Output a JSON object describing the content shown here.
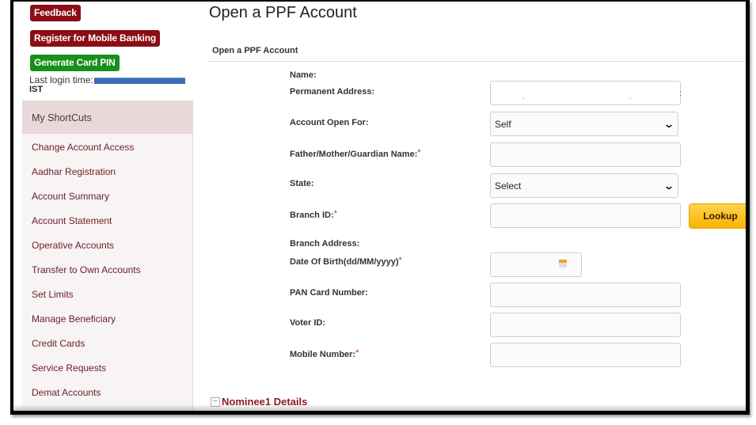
{
  "top_buttons": {
    "feedback": "Feedback",
    "register_mobile_banking": "Register for Mobile Banking",
    "generate_card_pin": "Generate Card PIN"
  },
  "last_login": {
    "label": "Last login time:",
    "timezone": "IST"
  },
  "sidebar": {
    "header": "My ShortCuts",
    "items": [
      {
        "label": "Change Account Access"
      },
      {
        "label": "Aadhar Registration"
      },
      {
        "label": "Account Summary"
      },
      {
        "label": "Account Statement"
      },
      {
        "label": "Operative Accounts"
      },
      {
        "label": "Transfer to Own Accounts"
      },
      {
        "label": "Set Limits"
      },
      {
        "label": "Manage Beneficiary"
      },
      {
        "label": "Credit Cards"
      },
      {
        "label": "Service Requests"
      },
      {
        "label": "Demat Accounts"
      }
    ]
  },
  "main": {
    "page_title": "Open a PPF Account",
    "section_title": "Open a PPF Account",
    "fields": {
      "name": {
        "label": "Name:"
      },
      "permanent_address": {
        "label": "Permanent Address:",
        "value": ""
      },
      "account_open_for": {
        "label": "Account Open For:",
        "value": "Self"
      },
      "guardian_name": {
        "label": "Father/Mother/Guardian Name:",
        "required": "*",
        "value": ""
      },
      "state": {
        "label": "State:",
        "value": "Select"
      },
      "branch_id": {
        "label": "Branch ID:",
        "required": "*",
        "value": ""
      },
      "branch_address": {
        "label": "Branch Address:"
      },
      "dob": {
        "label": "Date Of Birth(dd/MM/yyyy)",
        "required": "*",
        "value": ""
      },
      "pan": {
        "label": "PAN Card Number:",
        "value": ""
      },
      "voter_id": {
        "label": "Voter ID:",
        "value": ""
      },
      "mobile": {
        "label": "Mobile Number:",
        "required": "*",
        "value": ""
      }
    },
    "lookup_button": "Lookup",
    "nominee_section": {
      "toggle": "−",
      "title": "Nominee1 Details"
    }
  },
  "colors": {
    "brand_red": "#8b0e14",
    "brand_green": "#17901c",
    "lookup_yellow": "#f6b400",
    "required_star": "#d0243a"
  }
}
